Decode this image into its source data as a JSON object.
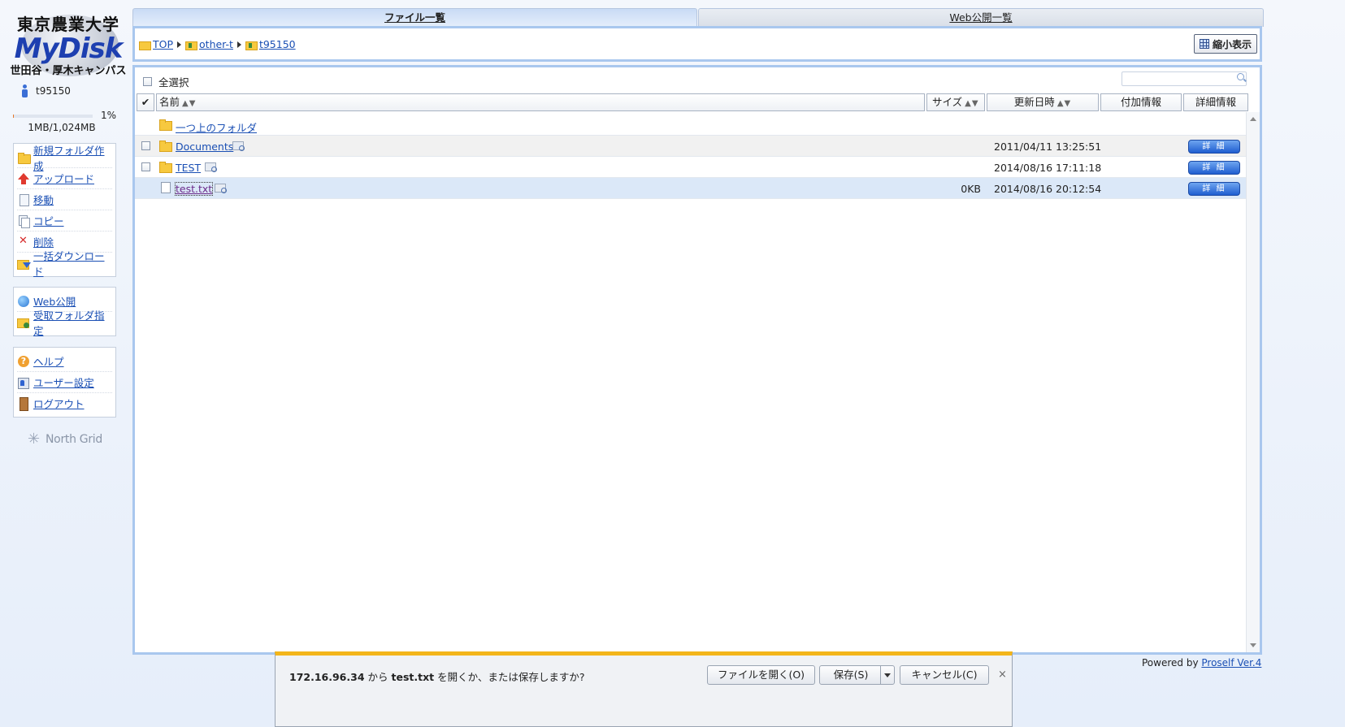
{
  "logo": {
    "college": "東京農業大学",
    "brand": "MyDisk",
    "campus": "世田谷・厚木キャンパス"
  },
  "user": {
    "name": "t95150"
  },
  "usage": {
    "percent": 1,
    "percent_label": "1%",
    "total": "1MB/1,024MB"
  },
  "sidebar": {
    "actions": [
      {
        "label": "新規フォルダ作成",
        "icon": "new-folder-icon"
      },
      {
        "label": "アップロード",
        "icon": "upload-icon"
      },
      {
        "label": "移動",
        "icon": "move-icon"
      },
      {
        "label": "コピー",
        "icon": "copy-icon"
      },
      {
        "label": "削除",
        "icon": "delete-icon"
      },
      {
        "label": "一括ダウンロード",
        "icon": "bulk-download-icon"
      }
    ],
    "web": [
      {
        "label": "Web公開",
        "icon": "globe-icon"
      },
      {
        "label": "受取フォルダ指定",
        "icon": "receive-folder-icon"
      }
    ],
    "account": [
      {
        "label": "ヘルプ",
        "icon": "help-icon"
      },
      {
        "label": "ユーザー設定",
        "icon": "user-settings-icon"
      },
      {
        "label": "ログアウト",
        "icon": "logout-icon"
      }
    ]
  },
  "north_grid": "North Grid",
  "tabs": {
    "files": "ファイル一覧",
    "web": "Web公開一覧"
  },
  "breadcrumb": [
    "TOP",
    "other-t",
    "t95150"
  ],
  "thumb_view_label": "縮小表示",
  "select_all_label": "全選択",
  "search": {
    "placeholder": ""
  },
  "columns": {
    "check": "✔",
    "name": "名前",
    "size": "サイズ",
    "date": "更新日時",
    "extra": "付加情報",
    "detail": "詳細情報",
    "sort": "▲▼"
  },
  "rows": [
    {
      "name": "一つ上のフォルダ",
      "type": "parent",
      "size": "",
      "date": ""
    },
    {
      "name": "Documents",
      "type": "folder",
      "size": "",
      "date": "2011/04/11 13:25:51",
      "detail": "詳 細"
    },
    {
      "name": "TEST",
      "type": "folder",
      "size": "",
      "date": "2014/08/16 17:11:18",
      "detail": "詳 細"
    },
    {
      "name": "test.txt",
      "type": "file",
      "size": "0KB",
      "date": "2014/08/16 20:12:54",
      "detail": "詳 細"
    }
  ],
  "powered": {
    "prefix": "Powered by ",
    "link": "Proself Ver.4"
  },
  "download_bar": {
    "host": "172.16.96.34",
    "from": " から ",
    "file": "test.txt",
    "question": " を開くか、または保存しますか?",
    "open_label": "ファイルを開く(O)",
    "save_label": "保存(S)",
    "cancel_label": "キャンセル(C)",
    "close_label": "×"
  },
  "colors": {
    "accent_border": "#a9c7ee",
    "link": "#1a4fb4",
    "notify_bar": "#f3b51a"
  }
}
